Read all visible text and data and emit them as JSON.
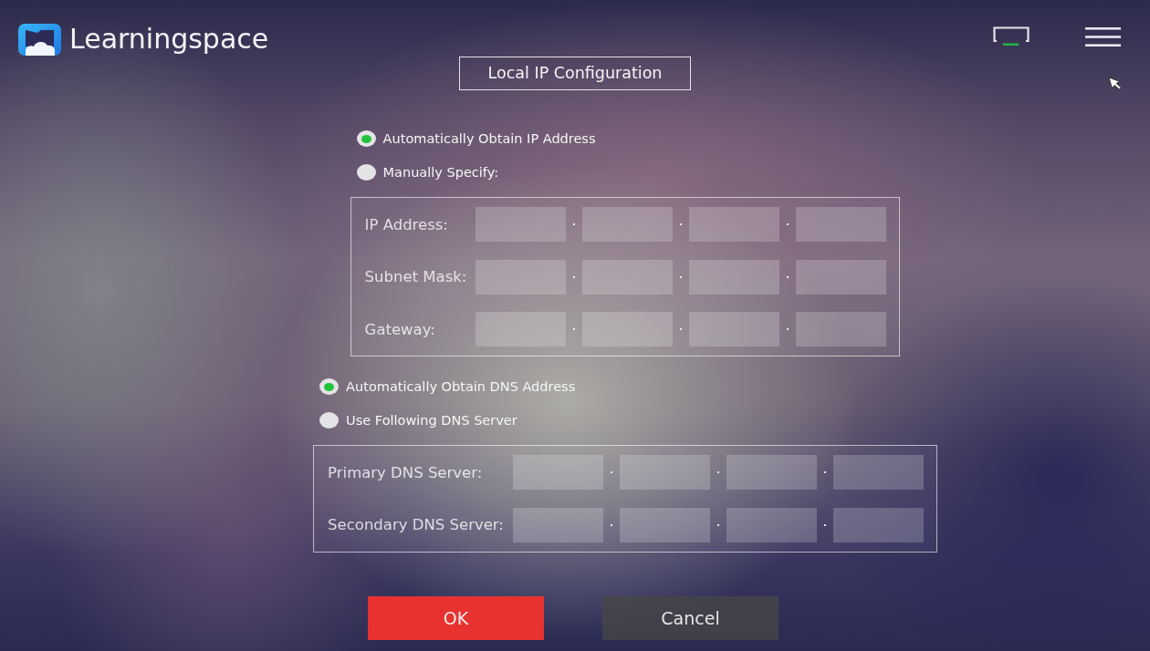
{
  "header": {
    "app_name": "Learningspace"
  },
  "title": "Local IP Configuration",
  "ip_settings": {
    "options": [
      {
        "label": "Automatically Obtain IP Address",
        "selected": true
      },
      {
        "label": "Manually Specify:",
        "selected": false
      }
    ],
    "fields": [
      {
        "label": "IP Address:"
      },
      {
        "label": "Subnet Mask:"
      },
      {
        "label": "Gateway:"
      }
    ]
  },
  "dns_settings": {
    "options": [
      {
        "label": "Automatically Obtain DNS Address",
        "selected": true
      },
      {
        "label": "Use Following DNS Server",
        "selected": false
      }
    ],
    "fields": [
      {
        "label": "Primary DNS Server:"
      },
      {
        "label": "Secondary DNS Server:"
      }
    ]
  },
  "buttons": [
    {
      "label": "OK",
      "kind": "primary"
    },
    {
      "label": "Cancel",
      "kind": "secondary"
    }
  ]
}
